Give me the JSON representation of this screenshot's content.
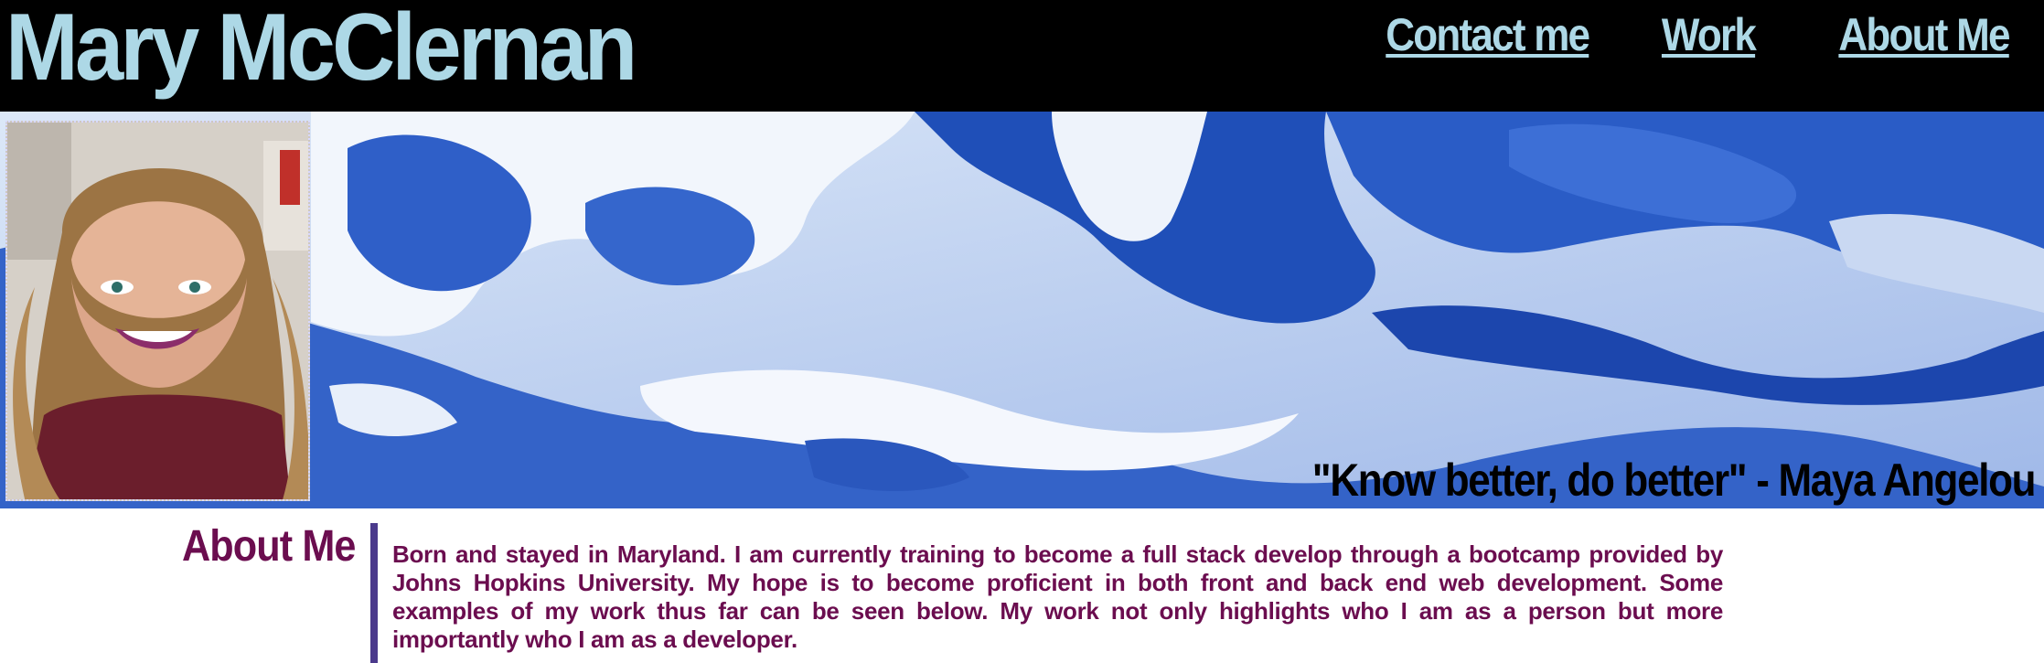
{
  "header": {
    "title": "Mary McClernan",
    "nav": [
      {
        "label": "Contact me"
      },
      {
        "label": "Work"
      },
      {
        "label": "About Me"
      }
    ]
  },
  "hero": {
    "background": "blue-marble-image",
    "portrait": "profile-photo",
    "quote": "\"Know better, do better\" - Maya Angelou"
  },
  "about": {
    "heading": "About Me",
    "body": "Born and stayed in Maryland. I am currently training to become a full stack develop through a bootcamp provided by Johns Hopkins University. My hope is to become proficient in both front and back end web development. Some examples of my work thus far can be seen below. My work not only highlights who I am as a person but more importantly who I am as a developer."
  },
  "colors": {
    "header_bg": "#000000",
    "title_color": "#add8e6",
    "about_color": "#6b0d4f",
    "rule_color": "#4b3a8c"
  }
}
